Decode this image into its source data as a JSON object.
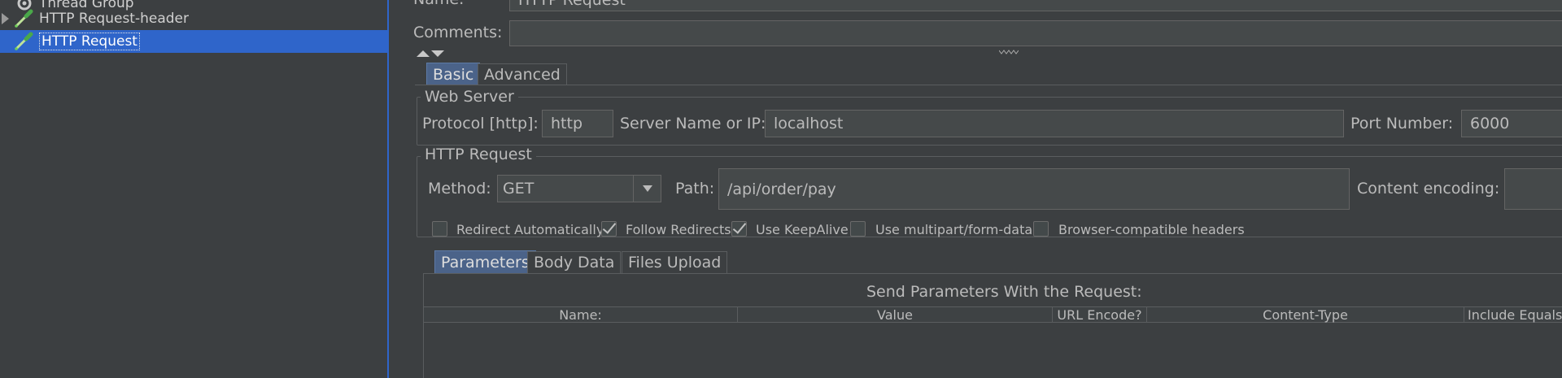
{
  "tree": {
    "items": [
      {
        "label": "Thread Group",
        "icon": "gear-icon"
      },
      {
        "label": "HTTP Request-header",
        "icon": "pipette-icon"
      },
      {
        "label": "HTTP Request",
        "icon": "pipette-icon",
        "selected": true
      }
    ]
  },
  "form": {
    "name_label": "Name:",
    "name_value": "HTTP Request",
    "comments_label": "Comments:",
    "comments_value": ""
  },
  "main_tabs": [
    {
      "label": "Basic",
      "active": true
    },
    {
      "label": "Advanced",
      "active": false
    }
  ],
  "web_server": {
    "legend": "Web Server",
    "protocol_label": "Protocol [http]:",
    "protocol_value": "http",
    "server_label": "Server Name or IP:",
    "server_value": "localhost",
    "port_label": "Port Number:",
    "port_value": "6000"
  },
  "http_request": {
    "legend": "HTTP Request",
    "method_label": "Method:",
    "method_value": "GET",
    "path_label": "Path:",
    "path_value": "/api/order/pay",
    "encoding_label": "Content encoding:",
    "encoding_value": ""
  },
  "options": [
    {
      "label": "Redirect Automatically",
      "checked": false
    },
    {
      "label": "Follow Redirects",
      "checked": true
    },
    {
      "label": "Use KeepAlive",
      "checked": true
    },
    {
      "label": "Use multipart/form-data",
      "checked": false
    },
    {
      "label": "Browser-compatible headers",
      "checked": false
    }
  ],
  "sub_tabs": [
    {
      "label": "Parameters",
      "active": true
    },
    {
      "label": "Body Data",
      "active": false
    },
    {
      "label": "Files Upload",
      "active": false
    }
  ],
  "params": {
    "title": "Send Parameters With the Request:",
    "columns": [
      "Name:",
      "Value",
      "URL Encode?",
      "Content-Type",
      "Include Equals"
    ]
  },
  "colors": {
    "background": "#3c3f41",
    "selection": "#2f65ca",
    "active_tab": "#4b6389",
    "field": "#45494a"
  }
}
